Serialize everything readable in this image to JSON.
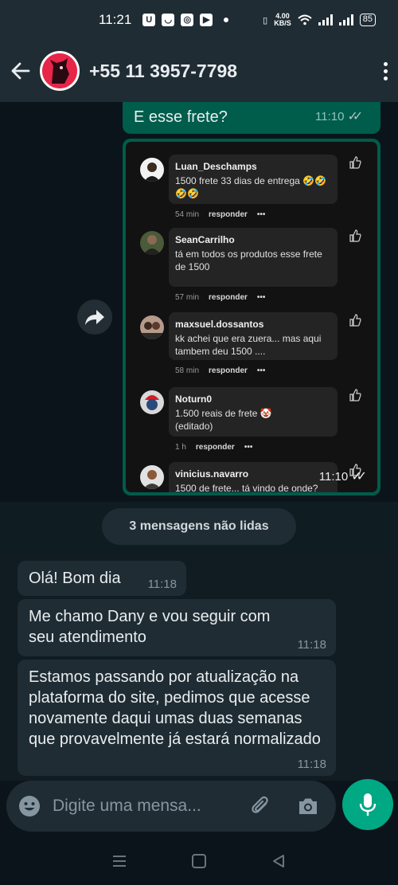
{
  "status_bar": {
    "time": "11:21",
    "net_speed_value": "4.00",
    "net_speed_unit": "KB/S",
    "battery": "85"
  },
  "header": {
    "contact": "+55 11 3957-7798"
  },
  "messages": {
    "prev_outgoing": {
      "text": "E esse frete?",
      "time": "11:10"
    },
    "image_time": "11:10",
    "incoming": [
      {
        "text": "Olá! Bom dia",
        "time": "11:18"
      },
      {
        "text": "Me chamo Dany e vou seguir com seu atendimento",
        "time": "11:18"
      },
      {
        "text": "Estamos passando por atualização na plataforma do site, pedimos que acesse novamente daqui umas duas semanas que provavelmente já estará normalizado",
        "time": "11:18"
      }
    ]
  },
  "screenshot_comments": [
    {
      "user": "Luan_Deschamps",
      "body": "1500 frete 33 dias de entrega 🤣🤣🤣🤣",
      "age": "54 min",
      "reply": "responder",
      "more": "•••"
    },
    {
      "user": "SeanCarrilho",
      "body": "tá em todos os produtos esse frete de 1500",
      "age": "57 min",
      "reply": "responder",
      "more": "•••"
    },
    {
      "user": "maxsuel.dossantos",
      "body": "kk achei que era zuera... mas aqui tambem deu 1500 ....",
      "age": "58 min",
      "reply": "responder",
      "more": "•••"
    },
    {
      "user": "Noturn0",
      "body": "1.500 reais de frete 🤡",
      "body2": "(editado)",
      "age": "1 h",
      "reply": "responder",
      "more": "•••"
    },
    {
      "user": "vinicius.navarro",
      "body": "1500 de frete... tá vindo de onde?"
    }
  ],
  "unread_label": "3 mensagens não lidas",
  "composer": {
    "placeholder": "Digite uma mensa..."
  },
  "colors": {
    "outgoing": "#005c4b",
    "incoming": "#1f2c34",
    "accent": "#00a884",
    "background": "#0b141a"
  }
}
